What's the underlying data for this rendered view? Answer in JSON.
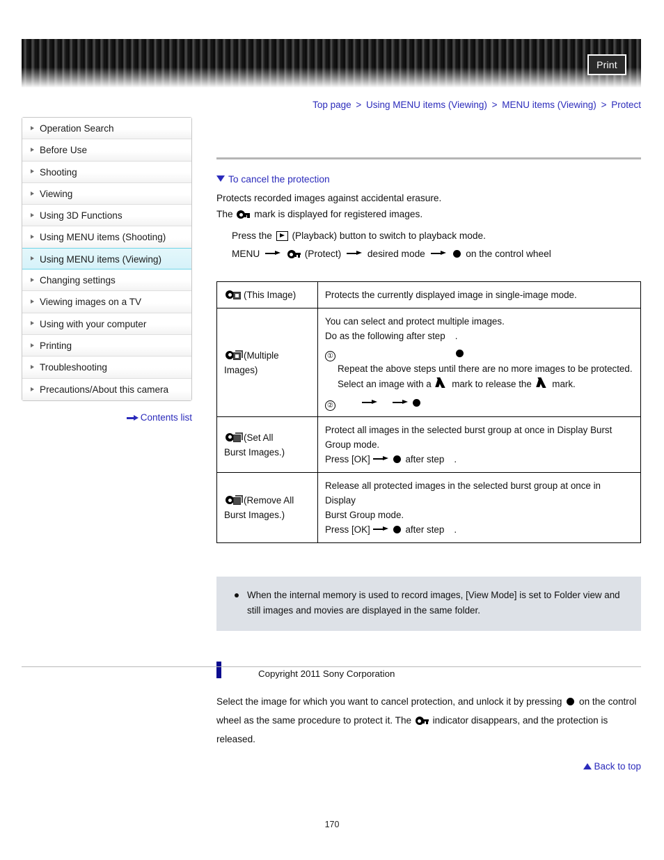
{
  "header": {
    "print_label": "Print"
  },
  "breadcrumb": {
    "separator": ">",
    "items": [
      {
        "label": "Top page"
      },
      {
        "label": "Using MENU items (Viewing)"
      },
      {
        "label": "MENU items (Viewing)"
      },
      {
        "label": "Protect"
      }
    ]
  },
  "sidebar": {
    "items": [
      {
        "label": "Operation Search",
        "active": false
      },
      {
        "label": "Before Use",
        "active": false
      },
      {
        "label": "Shooting",
        "active": false
      },
      {
        "label": "Viewing",
        "active": false
      },
      {
        "label": "Using 3D Functions",
        "active": false
      },
      {
        "label": "Using MENU items (Shooting)",
        "active": false
      },
      {
        "label": "Using MENU items (Viewing)",
        "active": true
      },
      {
        "label": "Changing settings",
        "active": false
      },
      {
        "label": "Viewing images on a TV",
        "active": false
      },
      {
        "label": "Using with your computer",
        "active": false
      },
      {
        "label": "Printing",
        "active": false
      },
      {
        "label": "Troubleshooting",
        "active": false
      },
      {
        "label": "Precautions/About this camera",
        "active": false
      }
    ],
    "contents_list_label": "Contents list"
  },
  "main": {
    "section_heading": "To cancel the protection",
    "intro_line_1": "Protects recorded images against accidental erasure.",
    "intro_line_2_before": "The",
    "intro_line_2_after": "mark is displayed for registered images.",
    "step_playback_before": "Press the",
    "step_playback_after": "(Playback) button to switch to playback mode.",
    "step_menu_1": "MENU",
    "step_menu_protect": "(Protect)",
    "step_menu_desired": "desired mode",
    "step_menu_wheel": "on the control wheel",
    "table": {
      "rows": [
        {
          "label": "(This Image)",
          "icon": "protect-single-image-icon",
          "lines": [
            {
              "text": "Protects the currently displayed image in single-image mode."
            }
          ]
        },
        {
          "label": "(Multiple Images)",
          "label_line_1": "(Multiple",
          "label_line_2": "Images)",
          "icon": "protect-multiple-images-icon",
          "lines": [
            {
              "text": "You can select and protect multiple images."
            },
            {
              "text_before": "Do as the following after step",
              "text_after": "."
            },
            {
              "marker": "①",
              "text": ""
            },
            {
              "text": "Repeat the above steps until there are no more images to be protected."
            },
            {
              "text_before": "Select an image with a",
              "text_mid": "mark to release the",
              "text_after": "mark."
            },
            {
              "marker": "②",
              "text": ""
            }
          ]
        },
        {
          "label": "(Set All Burst Images.)",
          "label_line_1": "(Set All",
          "label_line_2": "Burst Images.)",
          "icon": "protect-set-all-burst-icon",
          "lines": [
            {
              "text": "Protect all images in the selected burst group at once in Display Burst"
            },
            {
              "text": "Group mode."
            },
            {
              "text_before": "Press [OK]",
              "text_after": "after step",
              "text_end": "."
            }
          ]
        },
        {
          "label": "(Remove All Burst Images.)",
          "label_line_1": "(Remove All",
          "label_line_2": "Burst Images.)",
          "icon": "protect-remove-all-burst-icon",
          "lines": [
            {
              "text": "Release all protected images in the selected burst group at once in Display"
            },
            {
              "text": "Burst Group mode."
            },
            {
              "text_before": "Press [OK]",
              "text_after": "after step",
              "text_end": "."
            }
          ]
        }
      ]
    },
    "note": {
      "text": "When the internal memory is used to record images, [View Mode] is set to Folder view and still images and movies are displayed in the same folder."
    },
    "cancel_para_1": "Select the image for which you want to cancel protection, and unlock it by pressing",
    "cancel_para_2": "on the",
    "cancel_para_3": "control wheel as the same procedure to protect it. The",
    "cancel_para_4": "indicator disappears, and the",
    "cancel_para_5": "protection is released."
  },
  "footer": {
    "back_to_top_label": "Back to top",
    "copyright": "Copyright 2011 Sony Corporation",
    "page_number": "170"
  },
  "colors": {
    "link_blue": "#2b2bbb",
    "accent_bar": "#0b0b8f",
    "active_nav_bg": "#d6f2f9",
    "note_bg": "#dde1e7"
  }
}
